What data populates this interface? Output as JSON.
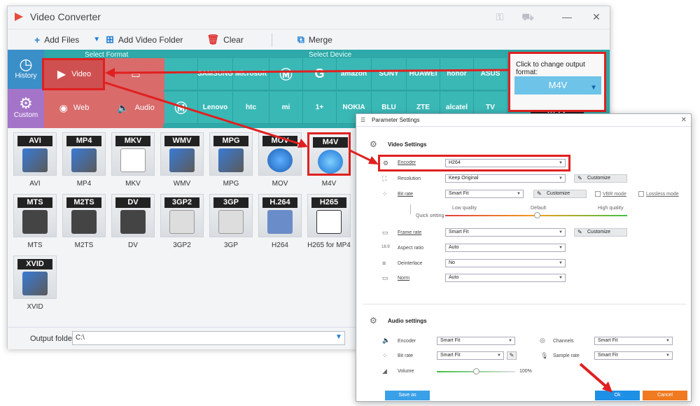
{
  "app": {
    "title": "Video Converter"
  },
  "toolbar": {
    "add_files": "Add Files",
    "add_video_folder": "Add Video Folder",
    "clear": "Clear",
    "merge": "Merge"
  },
  "sidebar": {
    "history": "History",
    "custom": "Custom"
  },
  "panel": {
    "select_format": "Select Format",
    "select_device": "Select Device",
    "format_tabs": [
      "Video",
      "Web",
      "Audio"
    ],
    "devices": [
      "SAMSUNG",
      "Microsoft",
      "amazon",
      "SONY",
      "HUAWEI",
      "honor",
      "ASUS",
      "Lenovo",
      "htc",
      "mi",
      "1+",
      "NOKIA",
      "BLU",
      "ZTE",
      "alcatel",
      "TV"
    ]
  },
  "output": {
    "label": "Click to change output format:",
    "selected": "M4V"
  },
  "formats": [
    "AVI",
    "MP4",
    "MKV",
    "WMV",
    "MPG",
    "MOV",
    "M4V",
    "MTS",
    "M2TS",
    "DV",
    "3GP2",
    "3GP",
    "H264",
    "H265 for MP4",
    "XVID"
  ],
  "format_tags": [
    "AVI",
    "MP4",
    "MKV",
    "WMV",
    "MPG",
    "MOV",
    "M4V",
    "MTS",
    "M2TS",
    "DV",
    "3GP2",
    "3GP",
    "H.264",
    "H265",
    "XVID"
  ],
  "output_folder": {
    "label": "Output folder:",
    "value": "C:\\"
  },
  "dialog": {
    "title": "Parameter Settings",
    "video_settings": "Video Settings",
    "encoder_label": "Encoder",
    "encoder_value": "H264",
    "resolution_label": "Resolution",
    "resolution_value": "Keep Original",
    "customize": "Customize",
    "bitrate_label": "Bit rate",
    "bitrate_value": "Smart Fit",
    "vbr_mode": "VBR mode",
    "lossless_mode": "Lossless mode",
    "low_quality": "Low quality",
    "default": "Default",
    "high_quality": "High quality",
    "quick_setting": "Quick setting",
    "framerate_label": "Frame rate",
    "framerate_value": "Smart Fit",
    "aspect_label": "Aspect ratio",
    "aspect_value": "Auto",
    "deinterlace_label": "Deinterlace",
    "deinterlace_value": "No",
    "norm_label": "Norm",
    "norm_value": "Auto",
    "audio_settings": "Audio settings",
    "a_encoder_label": "Encoder",
    "a_encoder_value": "Smart Fit",
    "channels_label": "Channels",
    "channels_value": "Smart Fit",
    "a_bitrate_label": "Bit rate",
    "a_bitrate_value": "Smart Fit",
    "samplerate_label": "Sample rate",
    "samplerate_value": "Smart Fit",
    "volume_label": "Volume",
    "volume_value": "100%",
    "save_as": "Save as",
    "ok": "Ok",
    "cancel": "Cancel"
  },
  "colors": {
    "accent_teal": "#2ea8a8",
    "highlight_red": "#e02020",
    "ok_blue": "#1e90e6",
    "cancel_orange": "#f07a20"
  }
}
